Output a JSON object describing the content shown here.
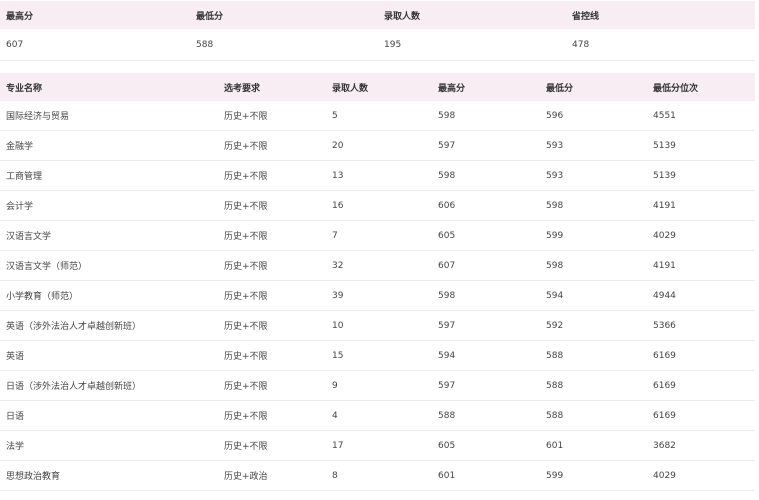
{
  "summary": {
    "headers": [
      "最高分",
      "最低分",
      "录取人数",
      "省控线"
    ],
    "values": [
      "607",
      "588",
      "195",
      "478"
    ]
  },
  "majors": {
    "headers": [
      "专业名称",
      "选考要求",
      "录取人数",
      "最高分",
      "最低分",
      "最低分位次"
    ],
    "rows": [
      [
        "国际经济与贸易",
        "历史+不限",
        "5",
        "598",
        "596",
        "4551"
      ],
      [
        "金融学",
        "历史+不限",
        "20",
        "597",
        "593",
        "5139"
      ],
      [
        "工商管理",
        "历史+不限",
        "13",
        "598",
        "593",
        "5139"
      ],
      [
        "会计学",
        "历史+不限",
        "16",
        "606",
        "598",
        "4191"
      ],
      [
        "汉语言文学",
        "历史+不限",
        "7",
        "605",
        "599",
        "4029"
      ],
      [
        "汉语言文学（师范）",
        "历史+不限",
        "32",
        "607",
        "598",
        "4191"
      ],
      [
        "小学教育（师范）",
        "历史+不限",
        "39",
        "598",
        "594",
        "4944"
      ],
      [
        "英语（涉外法治人才卓越创新班）",
        "历史+不限",
        "10",
        "597",
        "592",
        "5366"
      ],
      [
        "英语",
        "历史+不限",
        "15",
        "594",
        "588",
        "6169"
      ],
      [
        "日语（涉外法治人才卓越创新班）",
        "历史+不限",
        "9",
        "597",
        "588",
        "6169"
      ],
      [
        "日语",
        "历史+不限",
        "4",
        "588",
        "588",
        "6169"
      ],
      [
        "法学",
        "历史+不限",
        "17",
        "605",
        "601",
        "3682"
      ],
      [
        "思想政治教育",
        "历史+政治",
        "8",
        "601",
        "599",
        "4029"
      ]
    ]
  }
}
